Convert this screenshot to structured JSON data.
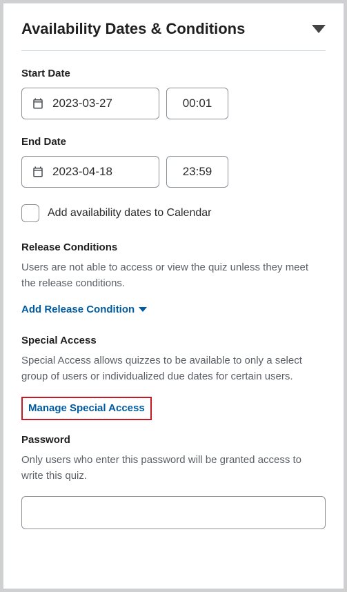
{
  "panel": {
    "title": "Availability Dates & Conditions"
  },
  "startDate": {
    "label": "Start Date",
    "date": "2023-03-27",
    "time": "00:01"
  },
  "endDate": {
    "label": "End Date",
    "date": "2023-04-18",
    "time": "23:59"
  },
  "calendarCheckbox": {
    "label": "Add availability dates to Calendar"
  },
  "releaseConditions": {
    "heading": "Release Conditions",
    "description": "Users are not able to access or view the quiz unless they meet the release conditions.",
    "action": "Add Release Condition"
  },
  "specialAccess": {
    "heading": "Special Access",
    "description": "Special Access allows quizzes to be available to only a select group of users or individualized due dates for certain users.",
    "action": "Manage Special Access"
  },
  "password": {
    "heading": "Password",
    "description": "Only users who enter this password will be granted access to write this quiz.",
    "value": ""
  }
}
